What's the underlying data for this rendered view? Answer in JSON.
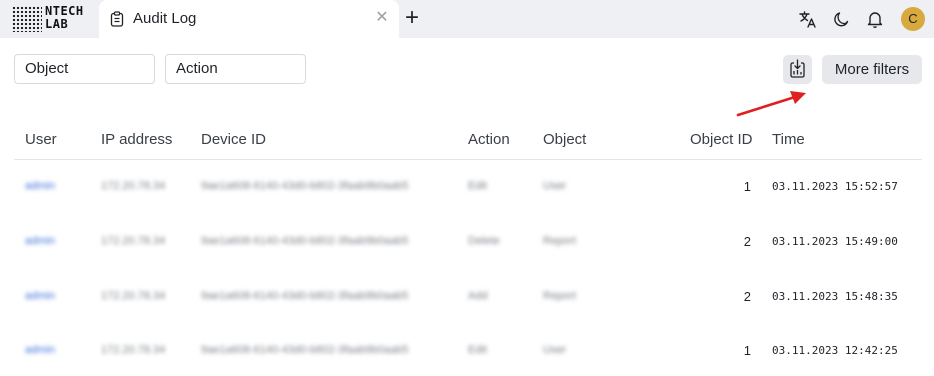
{
  "brand": {
    "line1": "NTECH",
    "line2": "LAB"
  },
  "tab": {
    "title": "Audit Log"
  },
  "user": {
    "avatar_initial": "C"
  },
  "filters": {
    "object": "Object",
    "action": "Action",
    "more_label": "More filters"
  },
  "table": {
    "columns": [
      "User",
      "IP address",
      "Device ID",
      "Action",
      "Object",
      "Object ID",
      "Time"
    ],
    "rows": [
      {
        "user": "admin",
        "ip": "172.20.78.34",
        "device": "9ae1a608-6140-43d0-b802-3faab9b0aab5",
        "action": "Edit",
        "object": "User",
        "object_id": "1",
        "time": "03.11.2023 15:52:57"
      },
      {
        "user": "admin",
        "ip": "172.20.78.34",
        "device": "9ae1a608-6140-43d0-b802-3faab9b0aab5",
        "action": "Delete",
        "object": "Report",
        "object_id": "2",
        "time": "03.11.2023 15:49:00"
      },
      {
        "user": "admin",
        "ip": "172.20.78.34",
        "device": "9ae1a608-6140-43d0-b802-3faab9b0aab5",
        "action": "Add",
        "object": "Report",
        "object_id": "2",
        "time": "03.11.2023 15:48:35"
      },
      {
        "user": "admin",
        "ip": "172.20.78.34",
        "device": "9ae1a608-6140-43d0-b802-3faab9b0aab5",
        "action": "Edit",
        "object": "User",
        "object_id": "1",
        "time": "03.11.2023 12:42:25"
      }
    ]
  },
  "colors": {
    "link": "#3b6fd8",
    "annotation_arrow": "#e02020",
    "avatar_bg": "#d7a93e",
    "tabbar_bg": "#eef0f4"
  }
}
